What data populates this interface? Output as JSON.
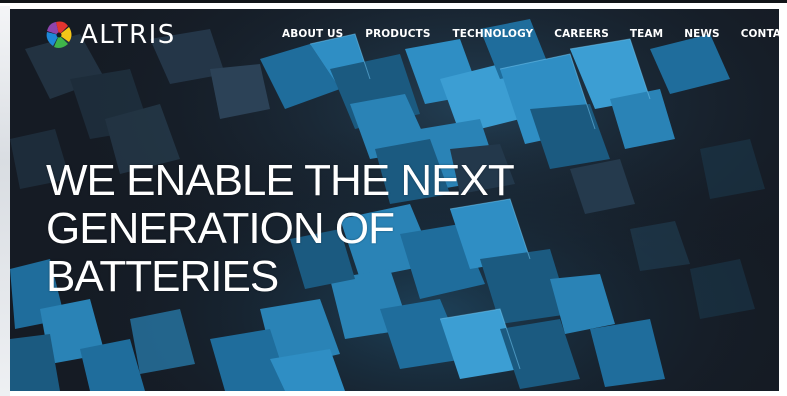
{
  "site": {
    "brand": "ALTRIS",
    "logo_icon": "pinwheel-logo-icon",
    "colors": {
      "hero_background": "#151b24",
      "crystal_blue": "#2f8ec4",
      "crystal_dark": "#1c5f86",
      "text": "#ffffff",
      "logo_red": "#e3342f",
      "logo_yellow": "#f5c518",
      "logo_green": "#3fb54a",
      "logo_blue": "#1e88d8",
      "logo_purple": "#8e44ad"
    }
  },
  "nav": {
    "items": [
      {
        "label": "ABOUT US"
      },
      {
        "label": "PRODUCTS"
      },
      {
        "label": "TECHNOLOGY"
      },
      {
        "label": "CAREERS"
      },
      {
        "label": "TEAM"
      },
      {
        "label": "NEWS"
      },
      {
        "label": "CONTACT"
      }
    ]
  },
  "hero": {
    "headline_lines": [
      "WE ENABLE THE NEXT",
      "GENERATION OF",
      "BATTERIES"
    ]
  }
}
